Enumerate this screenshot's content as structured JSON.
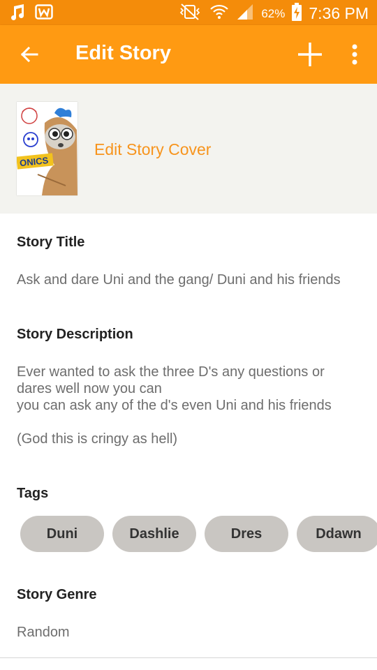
{
  "status_bar": {
    "battery_percent": "62%",
    "time": "7:36 PM",
    "icons": [
      "music-note-icon",
      "w-app-icon",
      "vibrate-off-icon",
      "wifi-icon",
      "signal-icon",
      "battery-charging-icon"
    ]
  },
  "toolbar": {
    "title": "Edit Story",
    "icons": [
      "back-arrow-icon",
      "plus-icon",
      "more-vert-icon"
    ]
  },
  "cover": {
    "link_label": "Edit Story Cover",
    "image_text": "ONICS"
  },
  "story": {
    "title_label": "Story Title",
    "title_value": "Ask and dare Uni and the gang/ Duni and his friends",
    "description_label": "Story Description",
    "description_value": "Ever wanted to ask the three D's any questions or\ndares well now you can\nyou can ask any of the d's even Uni and his friends\n\n(God this is cringy as hell)",
    "tags_label": "Tags",
    "tags": [
      "Duni",
      "Dashlie",
      "Dres",
      "Ddawn"
    ],
    "genre_label": "Story Genre",
    "genre_value": "Random"
  },
  "colors": {
    "status_bar": "#f48c0a",
    "toolbar": "#ff9a12",
    "accent": "#f7941d",
    "tag_bg": "#c9c6c2",
    "cover_section_bg": "#f3f3ef"
  }
}
